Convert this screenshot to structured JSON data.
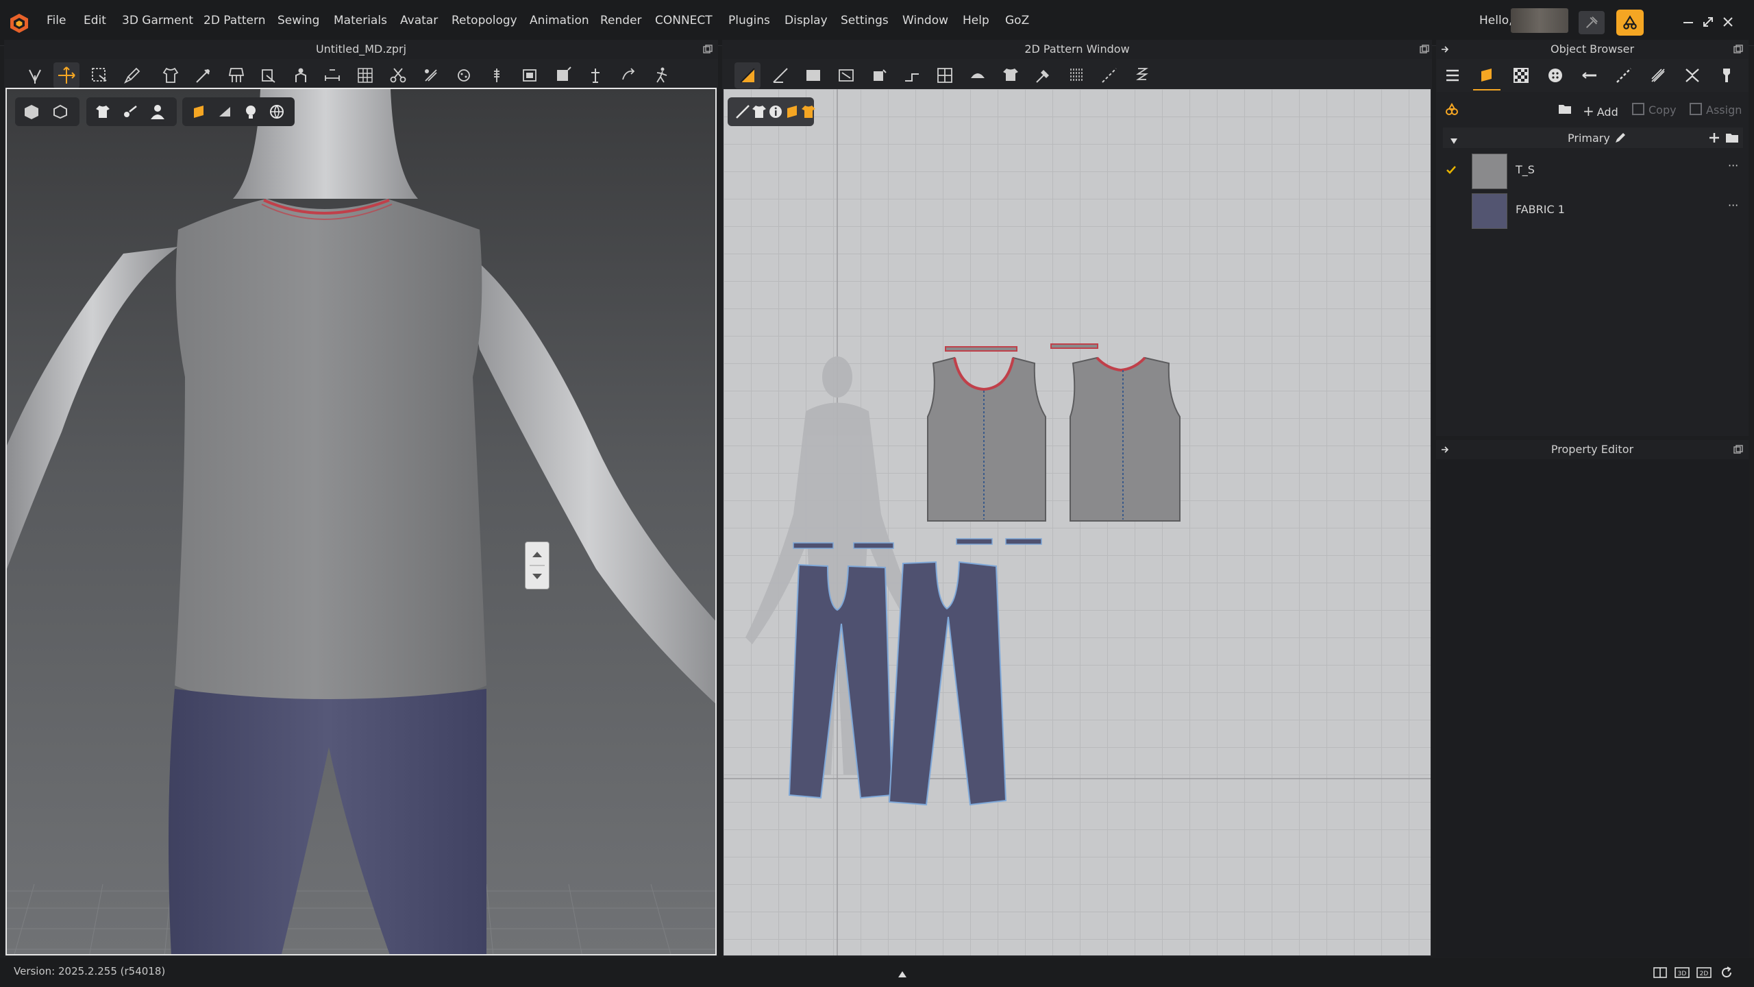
{
  "menubar": {
    "items": [
      "File",
      "Edit",
      "3D Garment",
      "2D Pattern",
      "Sewing",
      "Materials",
      "Avatar",
      "Retopology",
      "Animation",
      "Render",
      "CONNECT",
      "Plugins",
      "Display",
      "Settings",
      "Window",
      "Help",
      "GoZ"
    ],
    "greeting": "Hello,"
  },
  "viewport3d": {
    "title": "Untitled_MD.zprj"
  },
  "pattern_window": {
    "title": "2D Pattern Window"
  },
  "object_browser": {
    "title": "Object Browser",
    "add_label": "Add",
    "copy_label": "Copy",
    "assign_label": "Assign",
    "group_label": "Primary",
    "items": [
      {
        "name": "T_S",
        "color": "#8a8a8c",
        "checked": true
      },
      {
        "name": "FABRIC 1",
        "color": "#535571",
        "checked": false
      }
    ]
  },
  "property_editor": {
    "title": "Property Editor"
  },
  "status": {
    "version": "Version: 2025.2.255 (r54018)"
  },
  "colors": {
    "accent": "#f5a623",
    "selection": "#e8b400",
    "shirt": "#8a8a8c",
    "pants": "#4f5170",
    "seam": "#c0404a"
  }
}
